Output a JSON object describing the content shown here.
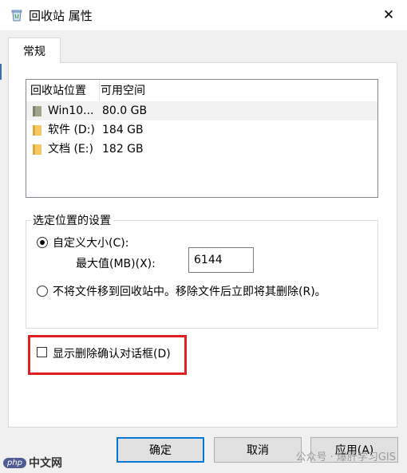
{
  "window": {
    "title": "回收站 属性",
    "close_glyph": "✕"
  },
  "tabs": [
    {
      "label": "常规"
    }
  ],
  "locations": {
    "headers": [
      "回收站位置",
      "可用空间"
    ],
    "rows": [
      {
        "name": "Win10...",
        "space": "80.0 GB",
        "icon": "drive-icon"
      },
      {
        "name": "软件 (D:)",
        "space": "184 GB",
        "icon": "folder-icon"
      },
      {
        "name": "文档 (E:)",
        "space": "182 GB",
        "icon": "folder-icon"
      }
    ]
  },
  "settings": {
    "legend": "选定位置的设置",
    "custom_size_label": "自定义大小(C):",
    "max_label": "最大值(MB)(X):",
    "max_value": "6144",
    "no_move_label": "不将文件移到回收站中。移除文件后立即将其删除(R)。",
    "selected_option": "custom"
  },
  "confirm_dialog": {
    "label": "显示删除确认对话框(D)",
    "checked": false
  },
  "buttons": {
    "ok": "确定",
    "cancel": "取消",
    "apply": "应用(A)"
  },
  "watermark": "公众号 · 爆肝学习GIS",
  "brand": {
    "badge": "php",
    "text": "中文网"
  },
  "colors": {
    "accent": "#0078d7",
    "highlight": "#e02020",
    "folder": "#f6c85f"
  }
}
